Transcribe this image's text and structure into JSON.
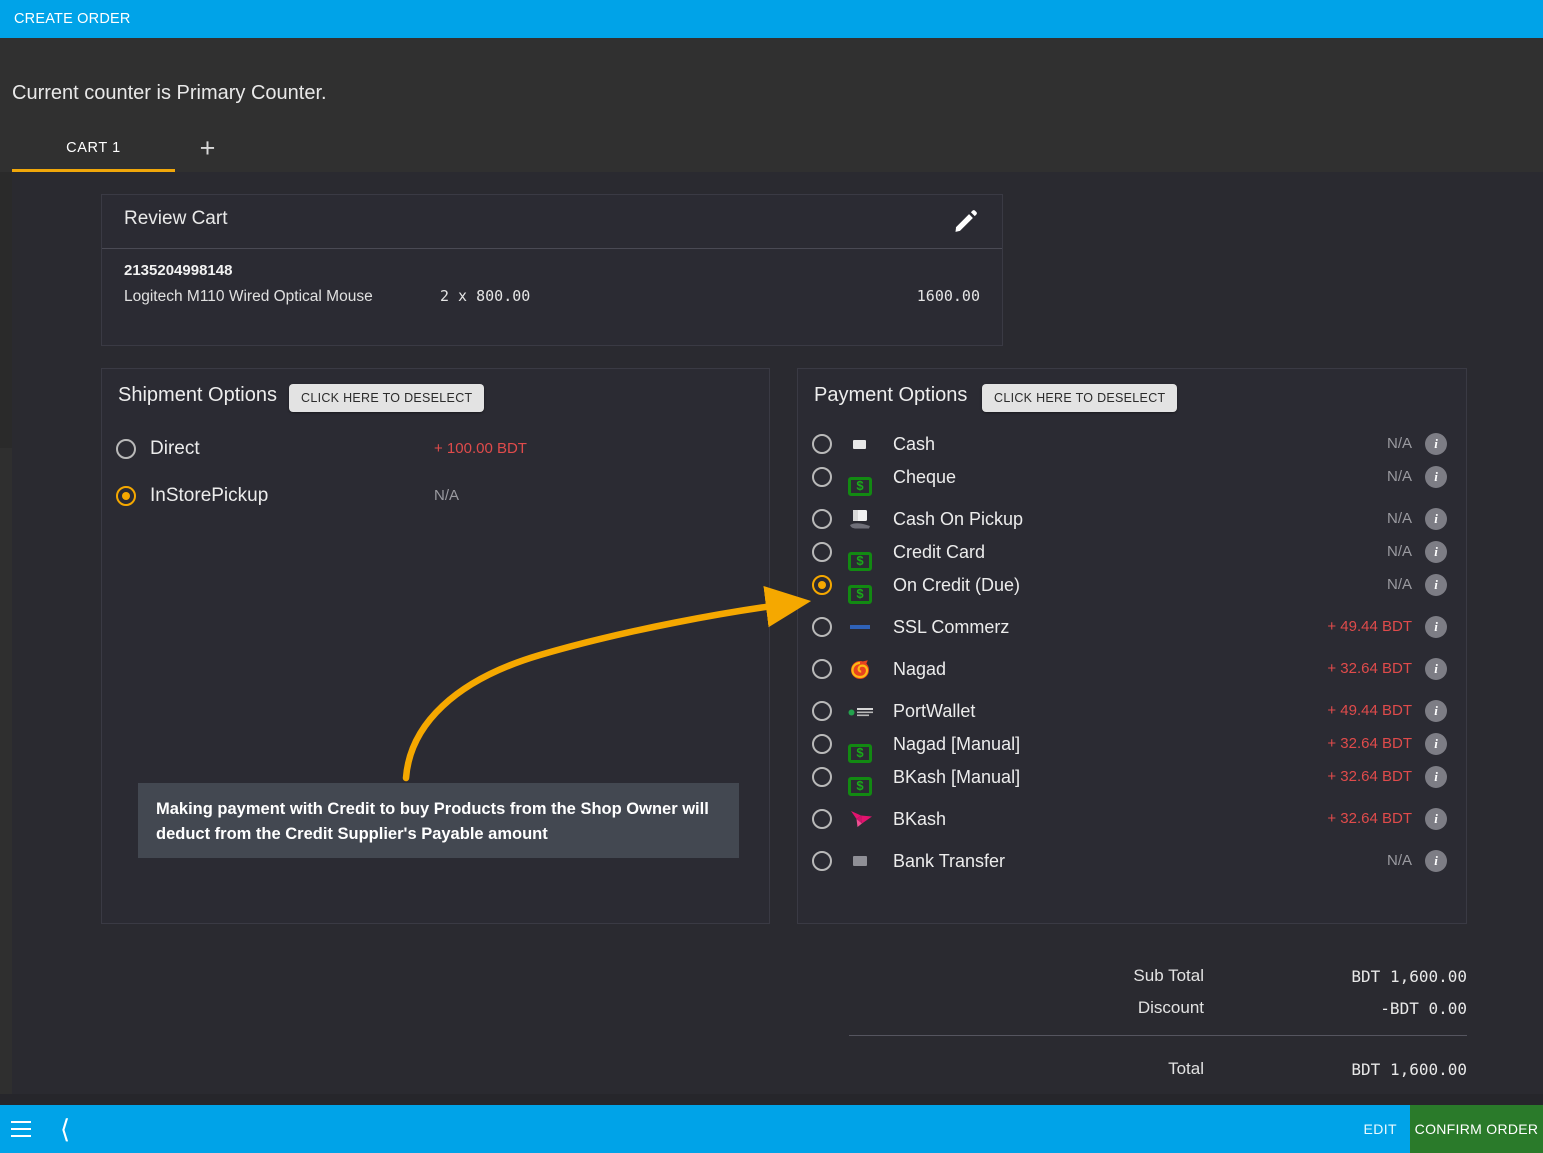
{
  "topbar": {
    "title": "CREATE ORDER"
  },
  "header": {
    "counter_text": "Current counter is Primary Counter.",
    "tab_label": "CART 1",
    "add_tab_icon": "+"
  },
  "review_cart": {
    "title": "Review Cart",
    "edit_icon": "pencil-icon",
    "item": {
      "sku": "2135204998148",
      "name": "Logitech M110 Wired Optical Mouse",
      "qty_price": "2 x  800.00",
      "amount": "1600.00"
    }
  },
  "shipment": {
    "title": "Shipment Options",
    "deselect_label": "CLICK HERE TO DESELECT",
    "options": [
      {
        "label": "Direct",
        "price": "+ 100.00 BDT",
        "price_kind": "plus",
        "selected": false
      },
      {
        "label": "InStorePickup",
        "price": "N/A",
        "price_kind": "na",
        "selected": true
      }
    ]
  },
  "payment": {
    "title": "Payment Options",
    "deselect_label": "CLICK HERE TO DESELECT",
    "info_icon": "i",
    "options": [
      {
        "label": "Cash",
        "icon": "cash-bill-icon",
        "price": "N/A",
        "price_kind": "na",
        "selected": false
      },
      {
        "label": "Cheque",
        "icon": "money-dollar-icon",
        "price": "N/A",
        "price_kind": "na",
        "selected": false
      },
      {
        "label": "Cash On Pickup",
        "icon": "hand-card-icon",
        "price": "N/A",
        "price_kind": "na",
        "selected": false
      },
      {
        "label": "Credit Card",
        "icon": "money-dollar-icon",
        "price": "N/A",
        "price_kind": "na",
        "selected": false
      },
      {
        "label": "On Credit (Due)",
        "icon": "money-dollar-icon",
        "price": "N/A",
        "price_kind": "na",
        "selected": true
      },
      {
        "label": "SSL Commerz",
        "icon": "sslcommerz-logo-icon",
        "price": "+ 49.44 BDT",
        "price_kind": "plus",
        "selected": false
      },
      {
        "label": "Nagad",
        "icon": "nagad-logo-icon",
        "price": "+ 32.64 BDT",
        "price_kind": "plus",
        "selected": false
      },
      {
        "label": "PortWallet",
        "icon": "portwallet-logo-icon",
        "price": "+ 49.44 BDT",
        "price_kind": "plus",
        "selected": false
      },
      {
        "label": "Nagad [Manual]",
        "icon": "money-dollar-icon",
        "price": "+ 32.64 BDT",
        "price_kind": "plus",
        "selected": false
      },
      {
        "label": "BKash [Manual]",
        "icon": "money-dollar-icon",
        "price": "+ 32.64 BDT",
        "price_kind": "plus",
        "selected": false
      },
      {
        "label": "BKash",
        "icon": "bkash-logo-icon",
        "price": "+ 32.64 BDT",
        "price_kind": "plus",
        "selected": false
      },
      {
        "label": "Bank Transfer",
        "icon": "bank-card-icon",
        "price": "N/A",
        "price_kind": "na",
        "selected": false
      }
    ]
  },
  "totals": {
    "rows": [
      {
        "label": "Sub Total",
        "value": "BDT 1,600.00"
      },
      {
        "label": "Discount",
        "value": "-BDT 0.00"
      }
    ],
    "total": {
      "label": "Total",
      "value": "BDT 1,600.00"
    }
  },
  "annotation": {
    "text": "Making payment with Credit to buy Products from the Shop Owner will deduct from the Credit Supplier's Payable amount",
    "arrow_color": "#f5a800"
  },
  "bottombar": {
    "menu_icon": "hamburger-icon",
    "back_icon": "chevron-left-icon",
    "edit_label": "EDIT",
    "confirm_label": "CONFIRM ORDER",
    "confirm_color": "#2a7a2a"
  },
  "colors": {
    "accent_blue": "#00a3e8",
    "accent_orange": "#f5a800",
    "price_red": "#e04b4b",
    "money_green": "#128a12"
  }
}
